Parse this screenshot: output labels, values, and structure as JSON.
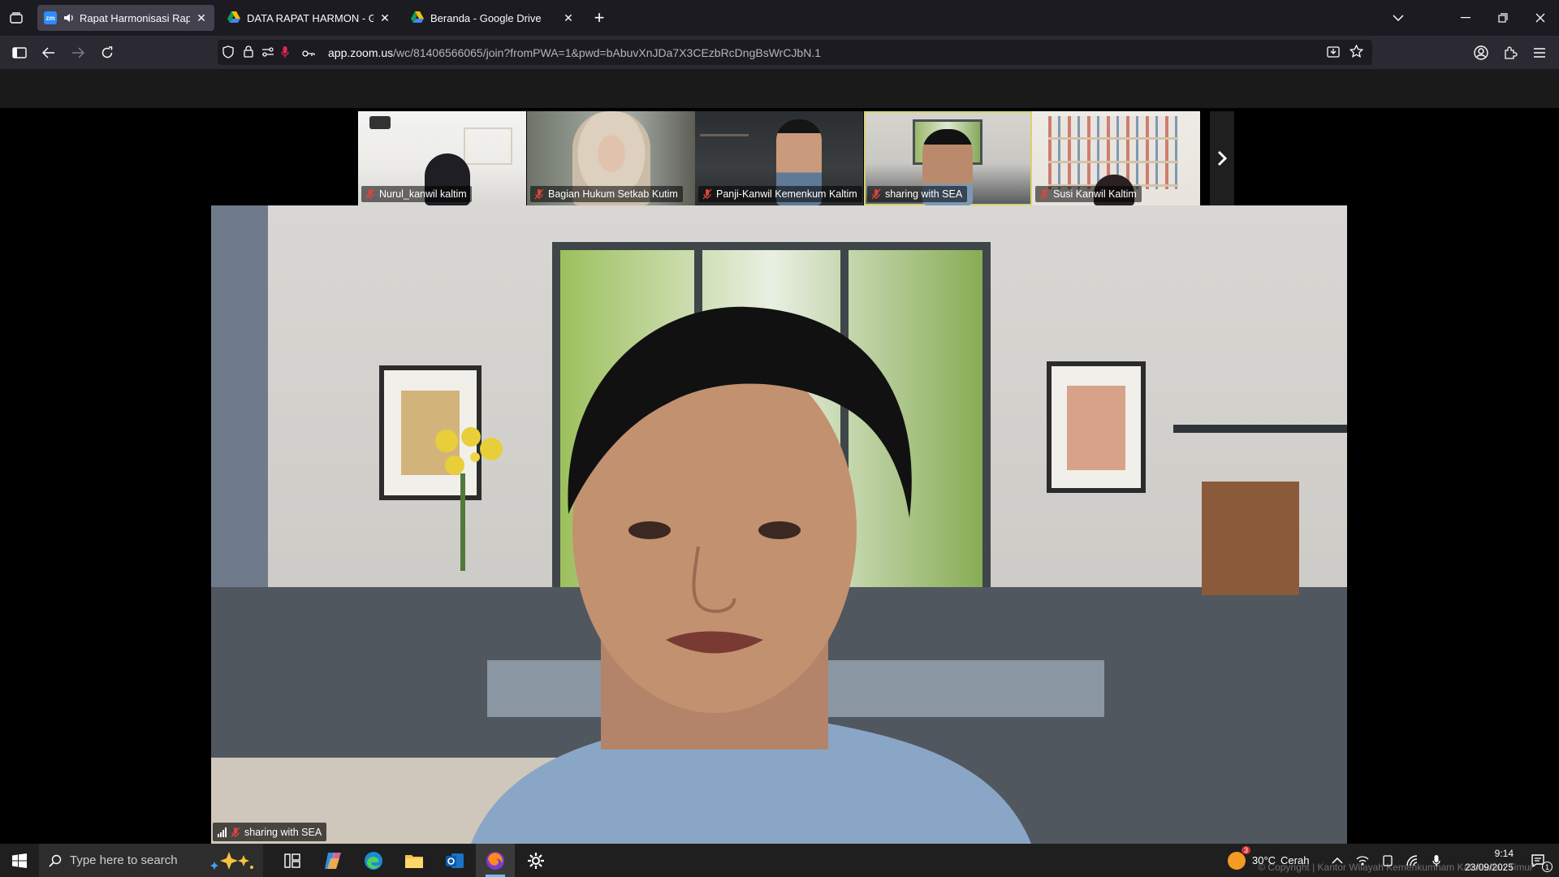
{
  "browser": {
    "tabs": [
      {
        "title": "Rapat Harmonisasi Raperbu",
        "favicon": "zoom-favicon",
        "favicon_text": "zm",
        "active": true,
        "audio": true
      },
      {
        "title": "DATA RAPAT HARMON - Googl",
        "favicon": "google-drive-icon",
        "active": false
      },
      {
        "title": "Beranda - Google Drive",
        "favicon": "google-drive-icon",
        "active": false
      }
    ],
    "new_tab_label": "+",
    "url_host": "app.zoom.us",
    "url_path": "/wc/81406566065/join?fromPWA=1&pwd=bAbuvXnJDa7X3CEzbRcDngBsWrCJbN.1"
  },
  "meeting": {
    "participants": [
      {
        "name": "Nurul_kanwil kaltim",
        "muted": true
      },
      {
        "name": "Bagian Hukum Setkab Kutim",
        "muted": true
      },
      {
        "name": "Panji-Kanwil Kemenkum Kaltim",
        "muted": true
      },
      {
        "name": "sharing with SEA",
        "muted": true,
        "active_speaker": true
      },
      {
        "name": "Susi Kanwil Kaltim",
        "muted": true
      }
    ],
    "main_speaker": "sharing with SEA",
    "watermark": "© Copyright | Kantor Wilayah Kemenkumham Kalimantan Timur"
  },
  "taskbar": {
    "search_placeholder": "Type here to search",
    "weather_temp": "30°C",
    "weather_text": "Cerah",
    "weather_badge": "3",
    "time": "9:14",
    "date": "23/09/2025",
    "notification_count": "1"
  },
  "colors": {
    "tab_strip": "#1c1b22",
    "nav_bar": "#2b2a33",
    "active_speaker_border": "#d7d36f",
    "taskbar": "#1f1f1f"
  }
}
